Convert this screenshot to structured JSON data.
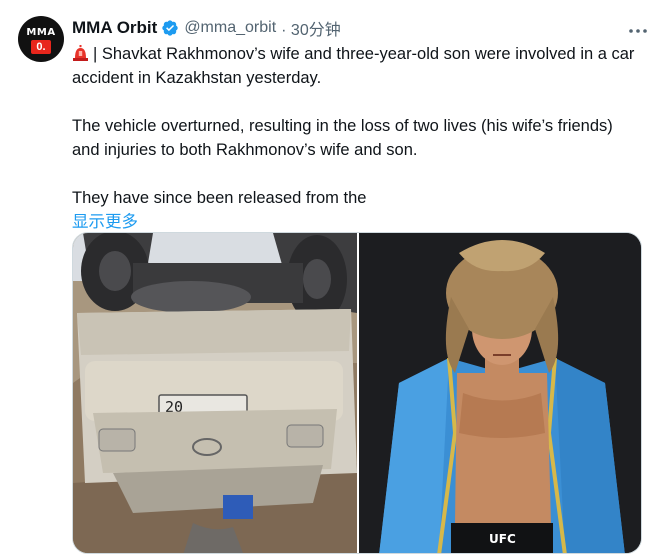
{
  "author": {
    "name": "MMA Orbit",
    "handle": "@mma_orbit",
    "time": "· 30分钟",
    "avatar_text": "MMA",
    "avatar_badge": "0."
  },
  "tweet": {
    "line1": "| Shavkat Rakhmonov’s wife and three-year-old son were involved in a car accident in Kazakhstan yesterday.",
    "line2": "The vehicle overturned, resulting in the loss of two lives (his wife’s friends) and injuries to both Rakhmonov’s wife and son.",
    "line3": "They have since been released from the",
    "show_more": "显示更多"
  },
  "media": {
    "plate_text": "20",
    "shorts_brand": "UFC"
  },
  "icons": {
    "siren": "siren-emoji-icon",
    "verified": "verified-badge-icon",
    "more": "more-icon"
  },
  "colors": {
    "accent": "#1d9bf0",
    "text": "#0f1419",
    "muted": "#536471",
    "badge_red": "#e8261c"
  }
}
